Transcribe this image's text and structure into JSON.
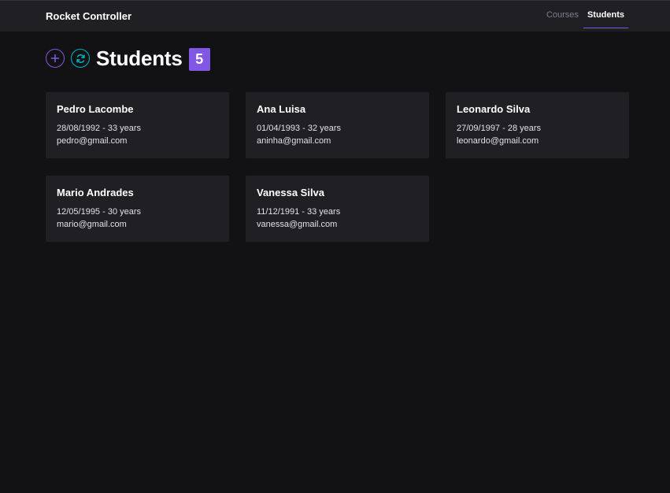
{
  "app": {
    "title": "Rocket Controller"
  },
  "nav": {
    "links": [
      {
        "label": "Courses",
        "active": false
      },
      {
        "label": "Students",
        "active": true
      }
    ]
  },
  "header": {
    "title": "Students",
    "count": "5"
  },
  "icons": {
    "add": "plus-icon",
    "refresh": "refresh-icon"
  },
  "colors": {
    "accent": "#8257e5",
    "refresh": "#00b5c6",
    "background": "#121214",
    "surface": "#202024"
  },
  "students": [
    {
      "name": "Pedro Lacombe",
      "birth": "28/08/1992 - 33 years",
      "email": "pedro@gmail.com"
    },
    {
      "name": "Ana Luisa",
      "birth": "01/04/1993 - 32 years",
      "email": "aninha@gmail.com"
    },
    {
      "name": "Leonardo Silva",
      "birth": "27/09/1997 - 28 years",
      "email": "leonardo@gmail.com"
    },
    {
      "name": "Mario Andrades",
      "birth": "12/05/1995 - 30 years",
      "email": "mario@gmail.com"
    },
    {
      "name": "Vanessa Silva",
      "birth": "11/12/1991 - 33 years",
      "email": "vanessa@gmail.com"
    }
  ]
}
